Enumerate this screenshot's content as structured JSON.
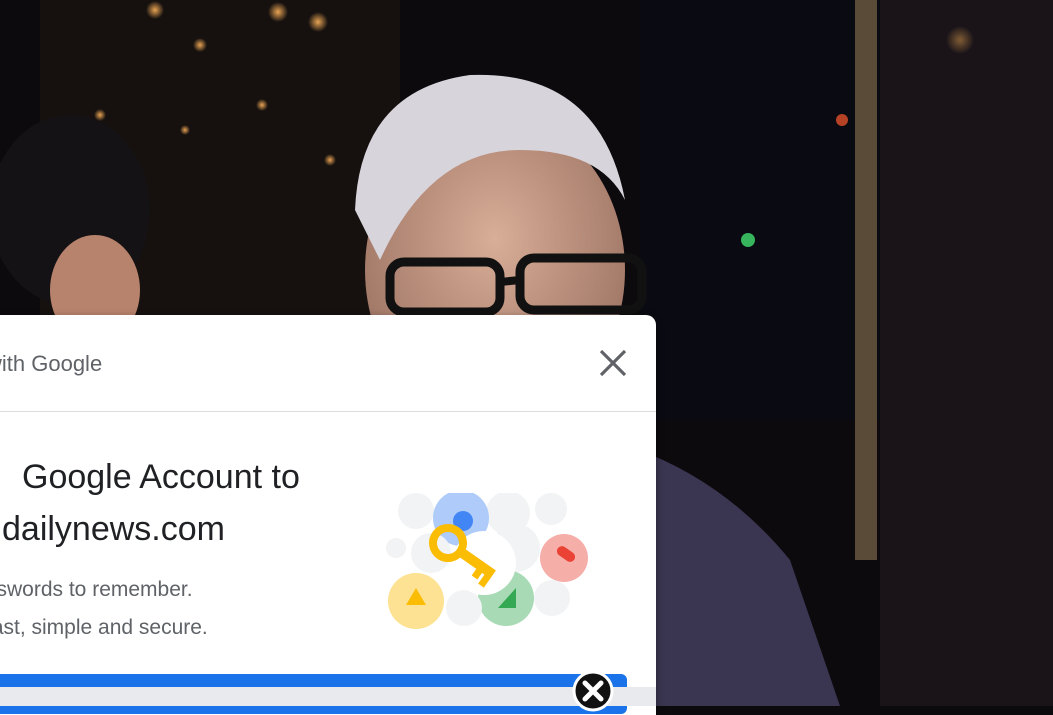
{
  "background_photo": {
    "description_icon": "photo-background",
    "colors": {
      "bar_dark": "#0d0a0e",
      "suit": "#3a3550",
      "hair": "#d8d4dc",
      "skin": "#c9a08c"
    }
  },
  "signin_dialog": {
    "header_title": "with Google",
    "headline_line1": "Google Account to",
    "headline_line2": "dailynews.com",
    "body_line1": "sswords to remember.",
    "body_line2": "fast, simple and secure.",
    "close_icon": "close-icon",
    "illustration_icon": "key-passkey-icon",
    "accent_color": "#1a73e8"
  },
  "overlay": {
    "dismiss_icon": "circle-close-icon"
  }
}
